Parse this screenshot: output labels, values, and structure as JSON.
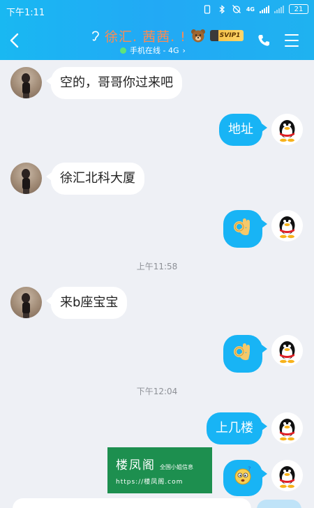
{
  "status_bar": {
    "time": "下午1:11",
    "network": "4G",
    "battery": "21"
  },
  "header": {
    "contact_name": "徐汇. 茜茜. !",
    "svip_label": "SVIP1",
    "online_status": "手机在线 - 4G",
    "chevron": "›",
    "colors": {
      "background": "#1fb2f0",
      "name": "#ff8a50",
      "online_dot": "#5fe37a"
    }
  },
  "messages": [
    {
      "side": "left",
      "text": "空的，哥哥你过来吧"
    },
    {
      "side": "right",
      "text": "地址"
    },
    {
      "side": "left",
      "text": "徐汇北科大厦"
    },
    {
      "side": "right",
      "emoji": "ok-hand-icon"
    },
    {
      "side": "left",
      "text": "来b座宝宝"
    },
    {
      "side": "right",
      "emoji": "ok-hand-icon"
    },
    {
      "side": "right",
      "text": "上几楼"
    },
    {
      "side": "right",
      "emoji": "confused-face-icon"
    }
  ],
  "timestamps": [
    "上午11:58",
    "下午12:04"
  ],
  "watermark": {
    "title": "楼凤阁",
    "subtitle": "全国小姐信息",
    "url": "https://楼凤阁.com"
  }
}
